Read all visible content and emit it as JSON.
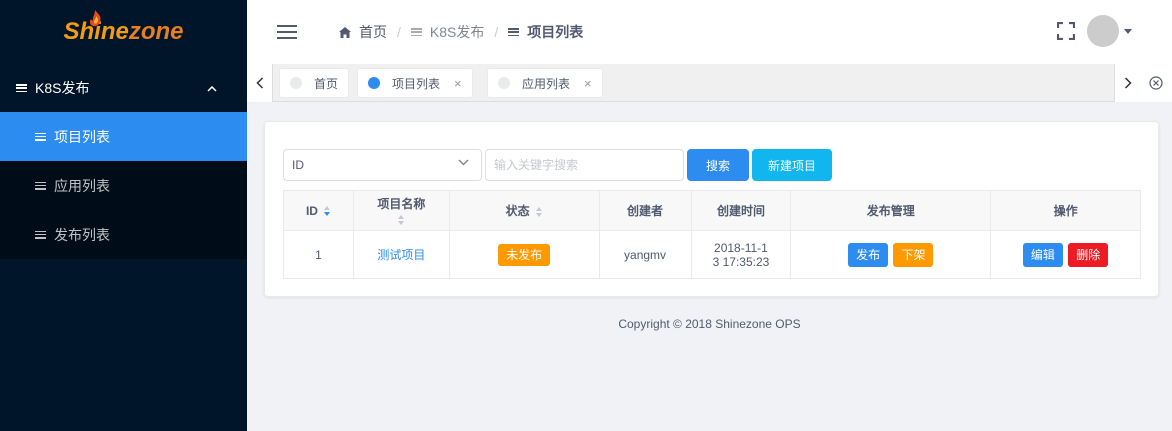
{
  "logo": {
    "part1": "Shine",
    "part2": "zone"
  },
  "sidebar": {
    "group_label": "K8S发布",
    "items": [
      {
        "label": "项目列表",
        "active": true
      },
      {
        "label": "应用列表",
        "active": false
      },
      {
        "label": "发布列表",
        "active": false
      }
    ]
  },
  "breadcrumb": {
    "home": "首页",
    "section": "K8S发布",
    "current": "项目列表"
  },
  "tabs": [
    {
      "label": "首页",
      "closable": false,
      "active": false
    },
    {
      "label": "项目列表",
      "closable": true,
      "active": true
    },
    {
      "label": "应用列表",
      "closable": true,
      "active": false
    }
  ],
  "search": {
    "field_select_value": "ID",
    "placeholder": "输入关键字搜索",
    "search_button": "搜索",
    "create_button": "新建项目"
  },
  "table": {
    "headers": {
      "id": "ID",
      "name": "项目名称",
      "status": "状态",
      "creator": "创建者",
      "created_time": "创建时间",
      "publish_mgmt": "发布管理",
      "actions": "操作"
    },
    "rows": [
      {
        "id": "1",
        "name": "测试项目",
        "status": "未发布",
        "creator": "yangmv",
        "created_time_line1": "2018-11-1",
        "created_time_line2": "3 17:35:23",
        "publish_button": "发布",
        "unpublish_button": "下架",
        "edit_button": "编辑",
        "delete_button": "删除"
      }
    ]
  },
  "footer": "Copyright © 2018 Shinezone OPS",
  "colors": {
    "sidebar_bg": "#001529",
    "accent": "#2d8cf0",
    "warning": "#ff9900",
    "danger": "#ed1c24",
    "create_button": "#11b6ee"
  }
}
